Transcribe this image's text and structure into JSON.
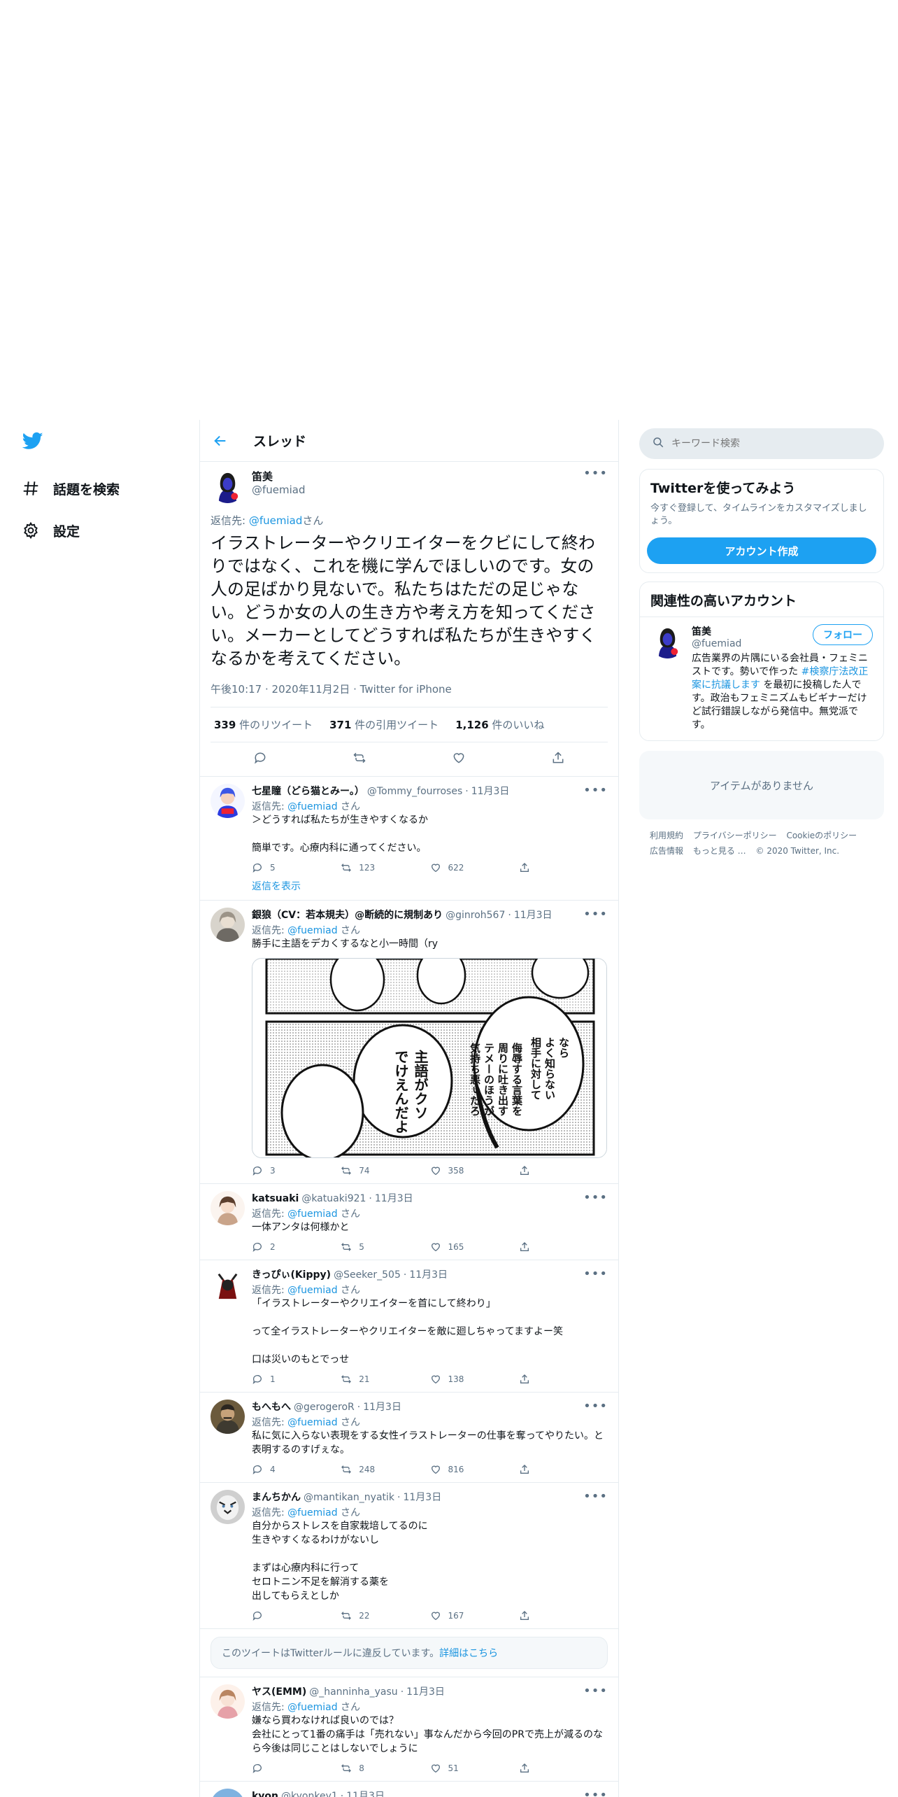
{
  "nav": {
    "items": [
      {
        "label": "話題を検索",
        "icon": "hashtag-icon"
      },
      {
        "label": "設定",
        "icon": "gear-icon"
      }
    ]
  },
  "header": {
    "title": "スレッド"
  },
  "focal": {
    "name": "笛美",
    "handle": "@fuemiad",
    "replying_prefix": "返信先: ",
    "replying_to": "@fuemiad",
    "replying_suffix": "さん",
    "text": "イラストレーターやクリエイターをクビにして終わりではなく、これを機に学んでほしいのです。女の人の足ばかり見ないで。私たちはただの足じゃない。どうか女の人の生き方や考え方を知ってください。メーカーとしてどうすれば私たちが生きやすくなるかを考えてください。",
    "time": "午後10:17",
    "date": "2020年11月2日",
    "source": "Twitter for iPhone",
    "retweets": "339",
    "retweets_label": " 件のリツイート",
    "quotes": "371",
    "quotes_label": " 件の引用ツイート",
    "likes": "1,126",
    "likes_label": " 件のいいね"
  },
  "replies": [
    {
      "name": "七星瞳（どら猫とみー。）",
      "handle": "@Tommy_fourroses",
      "date": "11月3日",
      "reply_to": "@fuemiad",
      "text": "＞どうすれば私たちが生きやすくなるか\n\n簡単です。心療内科に通ってください。",
      "replies": "5",
      "retweets": "123",
      "likes": "622",
      "show_replies": "返信を表示"
    },
    {
      "name": "銀狼（CV：若本規夫）@断続的に規制あり",
      "handle": "@ginroh567",
      "date": "11月3日",
      "reply_to": "@fuemiad",
      "text": "勝手に主語をデカくするなと小一時間（ry",
      "replies": "3",
      "retweets": "74",
      "likes": "358",
      "media_text": [
        "なら",
        "よく知らない",
        "相手に対して",
        "侮辱する言葉を",
        "周りに吐き出す",
        "テメーのほうが",
        "気持ち悪ぃだろ",
        "主語がクソ",
        "でけえんだよ"
      ]
    },
    {
      "name": "katsuaki",
      "handle": "@katuaki921",
      "date": "11月3日",
      "reply_to": "@fuemiad",
      "text": "一体アンタは何様かと",
      "replies": "2",
      "retweets": "5",
      "likes": "165"
    },
    {
      "name": "きっぴぃ(Kippy)",
      "handle": "@Seeker_505",
      "date": "11月3日",
      "reply_to": "@fuemiad",
      "text": "「イラストレーターやクリエイターを首にして終わり」\n\nって全イラストレーターやクリエイターを敵に廻しちゃってますよー笑\n\n口は災いのもとでっせ",
      "replies": "1",
      "retweets": "21",
      "likes": "138"
    },
    {
      "name": "もへもへ",
      "handle": "@gerogeroR",
      "date": "11月3日",
      "reply_to": "@fuemiad",
      "text": "私に気に入らない表現をする女性イラストレーターの仕事を奪ってやりたい。と表明するのすげぇな。",
      "replies": "4",
      "retweets": "248",
      "likes": "816"
    },
    {
      "name": "まんちかん",
      "handle": "@mantikan_nyatik",
      "date": "11月3日",
      "reply_to": "@fuemiad",
      "text": "自分からストレスを自家栽培してるのに\n生きやすくなるわけがないし\n\nまずは心療内科に行って\nセロトニン不足を解消する薬を\n出してもらえとしか",
      "replies": "",
      "retweets": "22",
      "likes": "167"
    },
    {
      "name": "ヤス(EMM)",
      "handle": "@_hanninha_yasu",
      "date": "11月3日",
      "reply_to": "@fuemiad",
      "text": "嫌なら買わなければ良いのでは？\n会社にとって1番の痛手は「売れない」事なんだから今回のPRで売上が減るのなら今後は同じことはしないでしょうに",
      "replies": "",
      "retweets": "8",
      "likes": "51"
    },
    {
      "name": "kyon",
      "handle": "@kyonkey1",
      "date": "11月3日"
    }
  ],
  "notice": {
    "text": "このツイートはTwitterルールに違反しています。",
    "link": "詳細はこちら"
  },
  "search": {
    "placeholder": "キーワード検索"
  },
  "signup": {
    "title": "Twitterを使ってみよう",
    "subtitle": "今すぐ登録して、タイムラインをカスタマイズしましょう。",
    "button": "アカウント作成"
  },
  "related": {
    "title": "関連性の高いアカウント",
    "name": "笛美",
    "handle": "@fuemiad",
    "follow": "フォロー",
    "bio_pre": "広告業界の片隅にいる会社員・フェミニストです。勢いで作った ",
    "bio_link": "#検察庁法改正案に抗議します",
    "bio_post": " を最初に投稿した人です。政治もフェミニズムもビギナーだけど試行錯誤しながら発信中。無党派です。"
  },
  "trends": {
    "empty": "アイテムがありません"
  },
  "footer": {
    "links": [
      "利用規約",
      "プライバシーポリシー",
      "Cookieのポリシー",
      "広告情報",
      "もっと見る …"
    ],
    "copyright": "© 2020 Twitter, Inc."
  },
  "colors": {
    "accent": "#1da1f2",
    "link": "#1b95e0",
    "muted": "#5b7083",
    "border": "#e6ecf0"
  }
}
